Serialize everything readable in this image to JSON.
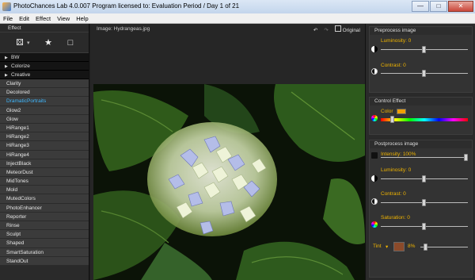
{
  "window": {
    "title": "PhotoChances Lab 4.0.007   Program licensed to: Evaluation Period / Day 1 of 21",
    "minimize_icon": "minimize-icon",
    "maximize_icon": "maximize-icon",
    "close_icon": "close-icon"
  },
  "menu": {
    "file": "File",
    "edit": "Edit",
    "effect": "Effect",
    "view": "View",
    "help": "Help"
  },
  "effect_panel": {
    "title": "Effect",
    "tools": [
      "dice-icon",
      "star-icon",
      "folder-icon"
    ],
    "categories": [
      "BW",
      "Colorize",
      "Creative"
    ],
    "items": [
      "Clarity",
      "Decolored",
      "DramaticPortraits",
      "Glow2",
      "Glow",
      "HiRange1",
      "HiRange2",
      "HiRange3",
      "HiRange4",
      "InjectBlack",
      "MeteorDust",
      "MidTones",
      "Mold",
      "MutedColors",
      "PhotoEnhancer",
      "Reporter",
      "Rinse",
      "Sculpt",
      "Shaped",
      "SmartSaturation",
      "StandOut"
    ],
    "selected": "DramaticPortraits",
    "selected_color": "#3fb8ff"
  },
  "image_view": {
    "label": "Image: Hydrangeas.jpg",
    "undo_icon": "undo-icon",
    "redo_icon": "redo-icon",
    "original_label": "Original",
    "original_checked": false
  },
  "preprocess": {
    "title": "Preprocess image",
    "luminosity": {
      "label": "Luminosity: 0",
      "value": 0.5
    },
    "contrast": {
      "label": "Contrast: 0",
      "value": 0.5
    }
  },
  "control_effect": {
    "title": "Control Effect",
    "color": {
      "label": "Color",
      "swatch": "#f0a000",
      "value": 0.12
    }
  },
  "postprocess": {
    "title": "Postprocess image",
    "intensity": {
      "label": "Intensity: 100%",
      "value": 1.0
    },
    "luminosity": {
      "label": "Luminosity: 0",
      "value": 0.5
    },
    "contrast": {
      "label": "Contrast: 0",
      "value": 0.5
    },
    "saturation": {
      "label": "Saturation: 0",
      "value": 0.5
    },
    "tint": {
      "label": "Tint",
      "swatch": "#8b4a2a",
      "percent": "8%",
      "value": 0.08
    }
  },
  "colors": {
    "accent": "#f0b400",
    "panel": "#2a2a2a",
    "list_item": "#3b3b3b"
  }
}
